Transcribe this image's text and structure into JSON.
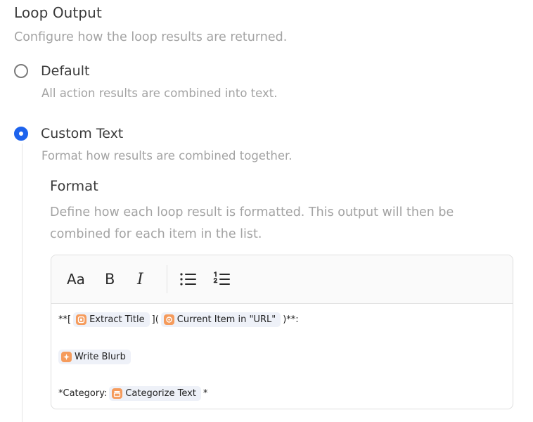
{
  "loop_output": {
    "title": "Loop Output",
    "description": "Configure how the loop results are returned.",
    "options": [
      {
        "label": "Default",
        "description": "All action results are combined into text.",
        "selected": false
      },
      {
        "label": "Custom Text",
        "description": "Format how results are combined together.",
        "selected": true
      }
    ]
  },
  "format": {
    "title": "Format",
    "description": "Define how each loop result is formatted. This output will then be combined for each item in the list."
  },
  "toolbar": {
    "font_size_label": "Aa",
    "bold_label": "B",
    "italic_label": "I",
    "icons": [
      "font-size-icon",
      "bold-icon",
      "italic-icon",
      "bullet-list-icon",
      "numbered-list-icon"
    ]
  },
  "editor": {
    "line1": {
      "prefix": "**[",
      "chip1": "Extract Title",
      "middle": "](",
      "chip2": "Current Item in \"URL\"",
      "suffix": ")**:"
    },
    "line2": {
      "chip1": "Write Blurb"
    },
    "line3": {
      "prefix": "*Category:",
      "chip1": "Categorize Text",
      "suffix": "*"
    }
  },
  "colors": {
    "accent": "#1d63ed",
    "chip_bg": "#eef1f8",
    "chip_icon": "#f59b5c",
    "muted_text": "#a3a3a3"
  }
}
